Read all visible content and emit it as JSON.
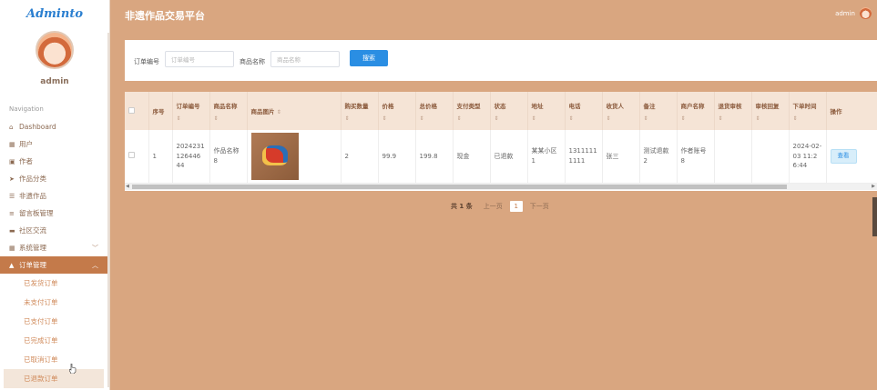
{
  "app": {
    "logo": "Adminto",
    "title": "非遗作品交易平台"
  },
  "user": {
    "name": "admin",
    "header_name": "admin"
  },
  "nav_title": "Navigation",
  "nav": [
    {
      "label": "Dashboard",
      "icon": "home-icon",
      "glyph": "⌂"
    },
    {
      "label": "用户",
      "icon": "grid-icon",
      "glyph": "▦"
    },
    {
      "label": "作者",
      "icon": "id-card-icon",
      "glyph": "▣"
    },
    {
      "label": "作品分类",
      "icon": "send-icon",
      "glyph": "➤"
    },
    {
      "label": "非遗作品",
      "icon": "sliders-icon",
      "glyph": "☰"
    },
    {
      "label": "留言板管理",
      "icon": "list-icon",
      "glyph": "≡"
    },
    {
      "label": "社区交流",
      "icon": "folder-icon",
      "glyph": "▬"
    },
    {
      "label": "系统管理",
      "icon": "grid-icon",
      "glyph": "▦"
    },
    {
      "label": "订单管理",
      "icon": "user-icon",
      "glyph": "▲"
    }
  ],
  "sub_nav": [
    "已发货订单",
    "未支付订单",
    "已支付订单",
    "已完成订单",
    "已取消订单",
    "已退款订单"
  ],
  "search": {
    "order_no_label": "订单编号",
    "order_no_placeholder": "订单编号",
    "product_label": "商品名称",
    "product_placeholder": "商品名称",
    "button": "搜索"
  },
  "table": {
    "headers": [
      "序号",
      "订单编号",
      "商品名称",
      "商品图片",
      "购买数量",
      "价格",
      "总价格",
      "支付类型",
      "状态",
      "地址",
      "电话",
      "收货人",
      "备注",
      "商户名称",
      "退货审核",
      "审核回复",
      "下单时间",
      "操作"
    ],
    "row": {
      "index": "1",
      "order_no": "2024231126446 44",
      "product": "作品名称8",
      "quantity": "2",
      "price": "99.9",
      "total": "199.8",
      "pay_type": "现金",
      "status": "已退款",
      "address": "某某小区1",
      "phone": "13111111111",
      "receiver": "张三",
      "remark": "测试退款2",
      "merchant": "作者账号8",
      "return_review": "",
      "review_reply": "",
      "order_time": "2024-02-03 11:26:44",
      "action": "查看"
    }
  },
  "pagination": {
    "total": "共 1 条",
    "prev": "上一页",
    "page": "1",
    "next": "下一页"
  }
}
